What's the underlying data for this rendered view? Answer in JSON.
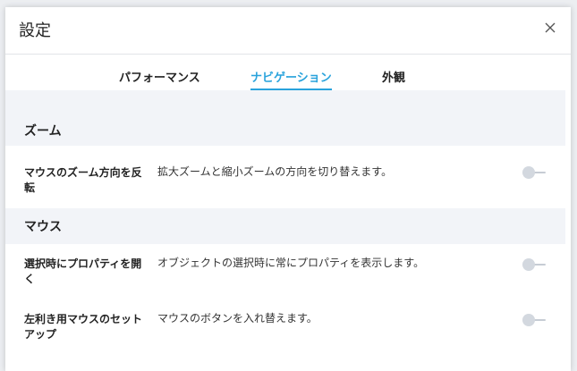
{
  "dialog": {
    "title": "設定",
    "close_icon": "close-icon"
  },
  "tabs": [
    {
      "label": "パフォーマンス",
      "active": false
    },
    {
      "label": "ナビゲーション",
      "active": true
    },
    {
      "label": "外観",
      "active": false
    }
  ],
  "sections": [
    {
      "title": "ズーム",
      "settings": [
        {
          "label": "マウスのズーム方向を反転",
          "description": "拡大ズームと縮小ズームの方向を切り替えます。",
          "enabled": false
        }
      ]
    },
    {
      "title": "マウス",
      "settings": [
        {
          "label": "選択時にプロパティを開く",
          "description": "オブジェクトの選択時に常にプロパティを表示します。",
          "enabled": false
        },
        {
          "label": "左利き用マウスのセットアップ",
          "description": "マウスのボタンを入れ替えます。",
          "enabled": false
        }
      ]
    }
  ],
  "colors": {
    "accent": "#29a3dc",
    "section_bg": "#f2f4f8",
    "toggle_off": "#d3d8df"
  }
}
